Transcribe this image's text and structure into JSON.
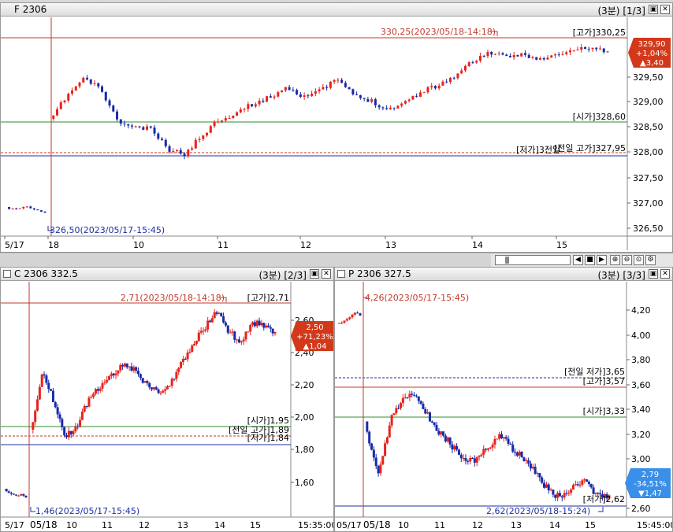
{
  "panels": {
    "main": {
      "title": "F 2306",
      "period": "(3분)",
      "index": "[1/3]",
      "price_box": {
        "price": "329,90",
        "change_pct": "+1,04%",
        "change": "▲3,40",
        "color": "#d2391a"
      },
      "annotations": {
        "high_marker": "330,25(2023/05/18-14:18)",
        "low_marker": "326,50(2023/05/17-15:45)",
        "high_line": "[고가]330,25",
        "open_line": "[시가]328,60",
        "low_line": "[저가]327,95",
        "prev_low_line": "[전일 고가]327,95",
        "low_line_overlap": "[저가]3전일"
      },
      "y_ticks": [
        "329,50",
        "329,00",
        "328,50",
        "328,00",
        "327,50",
        "327,00",
        "326,50"
      ],
      "x_ticks": [
        "5/17",
        "18",
        "10",
        "11",
        "12",
        "13",
        "14",
        "15"
      ]
    },
    "call": {
      "title": "C 2306 332.5",
      "period": "(3분)",
      "index": "[2/3]",
      "price_box": {
        "price": "2,50",
        "change_pct": "+71,23%",
        "change": "▲1,04",
        "color": "#d2391a"
      },
      "annotations": {
        "high_marker": "2,71(2023/05/18-14:18)",
        "low_marker": "1,46(2023/05/17-15:45)",
        "high_line": "[고가]2,71",
        "open_line": "[시가]1,95",
        "prev_high_line": "[전일 고가]1,89",
        "low_line": "[저가]1,84"
      },
      "y_ticks": [
        "2,60",
        "2,40",
        "2,20",
        "2,00",
        "1,80",
        "1,60"
      ],
      "x_ticks": [
        "5/17",
        "05/18",
        "10",
        "11",
        "12",
        "13",
        "14",
        "15",
        "15:35:00"
      ]
    },
    "put": {
      "title": "P 2306 327.5",
      "period": "(3분)",
      "index": "[3/3]",
      "price_box": {
        "price": "2,79",
        "change_pct": "-34,51%",
        "change": "▼1,47",
        "color": "#3a8fe8"
      },
      "annotations": {
        "high_marker": "4,26(2023/05/17-15:45)",
        "low_marker": "2,62(2023/05/18-15:24)",
        "prev_low_line": "[전일 저가]3,65",
        "high_line": "[고가]3,57",
        "open_line": "[시가]3,33",
        "low_line": "[저가]2,62"
      },
      "y_ticks": [
        "4,20",
        "4,00",
        "3,80",
        "3,60",
        "3,40",
        "3,20",
        "3,00",
        "2,80",
        "2,60"
      ],
      "x_ticks": [
        "05/17",
        "05/18",
        "10",
        "11",
        "12",
        "13",
        "14",
        "15",
        "15:45:00"
      ]
    }
  },
  "colors": {
    "up": "#e8231b",
    "down": "#1a2aa8",
    "high_line": "#c0392b",
    "open_line": "#2e8b2e",
    "low_line": "#1c2fa0"
  }
}
